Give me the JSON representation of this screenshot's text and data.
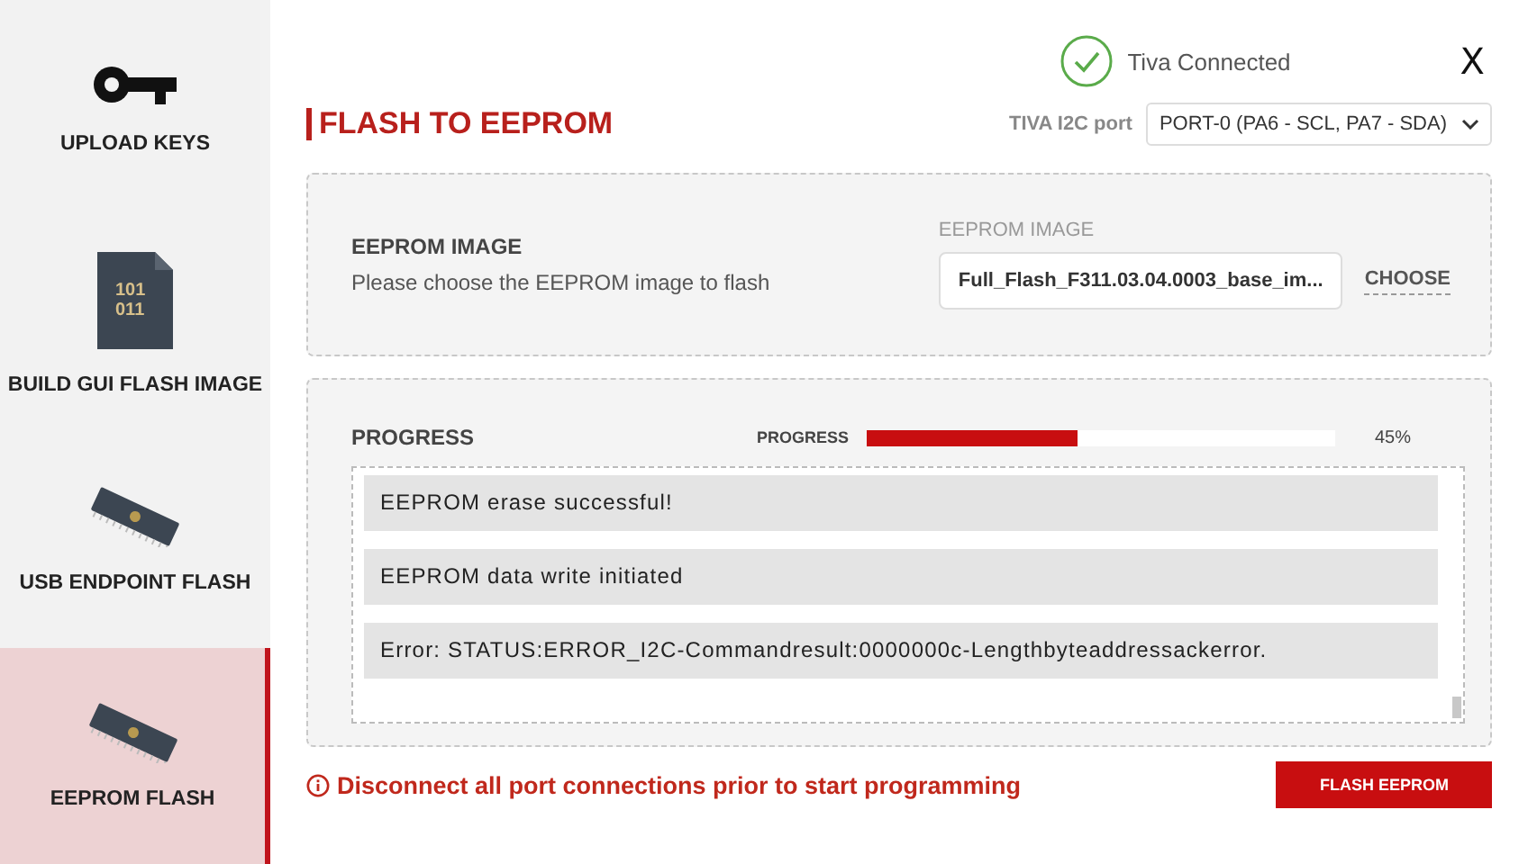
{
  "sidebar": {
    "items": [
      {
        "label": "UPLOAD KEYS",
        "kind": "key",
        "selected": false
      },
      {
        "label": "BUILD GUI FLASH IMAGE",
        "kind": "binary",
        "icon_text": [
          "101",
          "011"
        ],
        "selected": false
      },
      {
        "label": "USB ENDPOINT FLASH",
        "kind": "chip",
        "selected": false
      },
      {
        "label": "EEPROM FLASH",
        "kind": "chip",
        "selected": true
      }
    ]
  },
  "header": {
    "status": {
      "text": "Tiva Connected",
      "connected": true
    },
    "close": "X",
    "title": "FLASH TO EEPROM",
    "port_label": "TIVA I2C port",
    "port_value": "PORT-0 (PA6 - SCL, PA7 - SDA)"
  },
  "image_panel": {
    "title": "EEPROM IMAGE",
    "description": "Please choose the EEPROM image to flash",
    "field_label": "EEPROM IMAGE",
    "field_value": "Full_Flash_F311.03.04.0003_base_im...",
    "choose": "CHOOSE"
  },
  "progress_panel": {
    "title": "PROGRESS",
    "bar_label": "PROGRESS",
    "level": 0.45,
    "reading": "45%",
    "log": [
      "EEPROM erase successful!",
      "EEPROM data write initiated",
      "Error: STATUS:ERROR_I2C-Commandresult:0000000c-Lengthbyteaddressackerror."
    ]
  },
  "warning": "Disconnect all port connections prior to start programming",
  "flash_button": "FLASH EEPROM"
}
